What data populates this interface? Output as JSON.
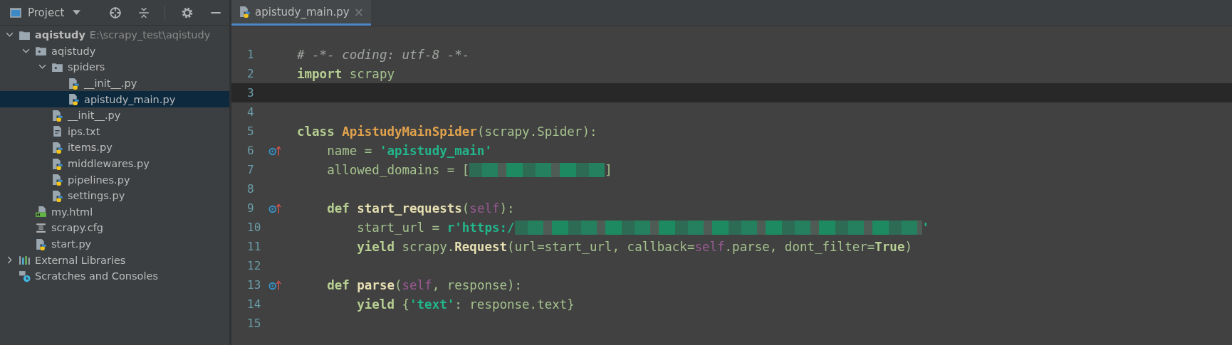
{
  "project_panel": {
    "title": "Project",
    "tree": [
      {
        "label": "aqistudy",
        "path": "E:\\scrapy_test\\aqistudy",
        "kind": "folder",
        "expanded": true,
        "selected": false,
        "children": [
          {
            "label": "aqistudy",
            "kind": "package",
            "expanded": true,
            "selected": false,
            "children": [
              {
                "label": "spiders",
                "kind": "package",
                "expanded": true,
                "selected": false,
                "children": [
                  {
                    "label": "__init__.py",
                    "kind": "python",
                    "selected": false
                  },
                  {
                    "label": "apistudy_main.py",
                    "kind": "python",
                    "selected": true
                  }
                ]
              },
              {
                "label": "__init__.py",
                "kind": "python",
                "selected": false
              },
              {
                "label": "ips.txt",
                "kind": "text",
                "selected": false
              },
              {
                "label": "items.py",
                "kind": "python",
                "selected": false
              },
              {
                "label": "middlewares.py",
                "kind": "python",
                "selected": false
              },
              {
                "label": "pipelines.py",
                "kind": "python",
                "selected": false
              },
              {
                "label": "settings.py",
                "kind": "python",
                "selected": false
              }
            ]
          },
          {
            "label": "my.html",
            "kind": "html",
            "selected": false
          },
          {
            "label": "scrapy.cfg",
            "kind": "config",
            "selected": false
          },
          {
            "label": "start.py",
            "kind": "python",
            "selected": false
          }
        ]
      },
      {
        "label": "External Libraries",
        "kind": "libraries",
        "expanded": false,
        "selected": false
      },
      {
        "label": "Scratches and Consoles",
        "kind": "scratches",
        "selected": false
      }
    ]
  },
  "tabs": [
    {
      "label": "apistudy_main.py",
      "close": "×",
      "selected": true
    }
  ],
  "editor": {
    "lines": [
      {
        "number": "1",
        "current": false,
        "marker": false,
        "kind": "module",
        "tokens": [
          {
            "kind": "comment",
            "text": "# -*- coding: utf-8 -*-"
          }
        ]
      },
      {
        "number": "2",
        "current": false,
        "marker": false,
        "kind": "module",
        "tokens": [
          {
            "kind": "keyword",
            "text": "import "
          },
          {
            "kind": "text",
            "text": "scrapy"
          }
        ]
      },
      {
        "number": "3",
        "current": true,
        "marker": false
      },
      {
        "number": "4",
        "current": false,
        "marker": false
      },
      {
        "number": "5",
        "current": false,
        "marker": false,
        "kind": "module",
        "tokens": [
          {
            "kind": "keyword",
            "text": "class "
          },
          {
            "kind": "class",
            "text": "ApistudyMainSpider"
          },
          {
            "kind": "text",
            "text": "(scrapy.Spider):"
          }
        ]
      },
      {
        "number": "6",
        "current": false,
        "marker": true,
        "kind": "member",
        "tokens": [
          {
            "kind": "text",
            "text": "name = "
          },
          {
            "kind": "string",
            "text": "'apistudy_main'"
          }
        ]
      },
      {
        "number": "7",
        "current": false,
        "marker": false,
        "kind": "member",
        "tokens": [
          {
            "kind": "text",
            "text": "allowed_domains = ["
          },
          {
            "kind": "redacted-short"
          },
          {
            "kind": "text",
            "text": "]"
          }
        ]
      },
      {
        "number": "8",
        "current": false,
        "marker": false
      },
      {
        "number": "9",
        "current": false,
        "marker": true,
        "kind": "member",
        "tokens": [
          {
            "kind": "keyword",
            "text": "def "
          },
          {
            "kind": "func",
            "text": "start_requests"
          },
          {
            "kind": "text",
            "text": "("
          },
          {
            "kind": "self",
            "text": "self"
          },
          {
            "kind": "text",
            "text": "):"
          }
        ]
      },
      {
        "number": "10",
        "current": false,
        "marker": false,
        "kind": "body",
        "tokens": [
          {
            "kind": "text",
            "text": "start_url = "
          },
          {
            "kind": "string",
            "text": "r'https:/"
          },
          {
            "kind": "redacted-long"
          },
          {
            "kind": "string",
            "text": "'"
          }
        ]
      },
      {
        "number": "11",
        "current": false,
        "marker": false,
        "kind": "body",
        "tokens": [
          {
            "kind": "keyword",
            "text": "yield "
          },
          {
            "kind": "text",
            "text": "scrapy."
          },
          {
            "kind": "func",
            "text": "Request"
          },
          {
            "kind": "text",
            "text": "(url=start_url, callback="
          },
          {
            "kind": "self",
            "text": "self"
          },
          {
            "kind": "text",
            "text": ".parse, dont_filter="
          },
          {
            "kind": "keyword",
            "text": "True"
          },
          {
            "kind": "text",
            "text": ")"
          }
        ]
      },
      {
        "number": "12",
        "current": false,
        "marker": false
      },
      {
        "number": "13",
        "current": false,
        "marker": true,
        "kind": "member",
        "tokens": [
          {
            "kind": "keyword",
            "text": "def "
          },
          {
            "kind": "func",
            "text": "parse"
          },
          {
            "kind": "text",
            "text": "("
          },
          {
            "kind": "self",
            "text": "self"
          },
          {
            "kind": "text",
            "text": ", response):"
          }
        ]
      },
      {
        "number": "14",
        "current": false,
        "marker": false,
        "kind": "body",
        "tokens": [
          {
            "kind": "keyword",
            "text": "yield "
          },
          {
            "kind": "text",
            "text": "{"
          },
          {
            "kind": "string",
            "text": "'text'"
          },
          {
            "kind": "text",
            "text": ": response.text}"
          }
        ]
      },
      {
        "number": "15",
        "current": false,
        "marker": false
      }
    ]
  }
}
